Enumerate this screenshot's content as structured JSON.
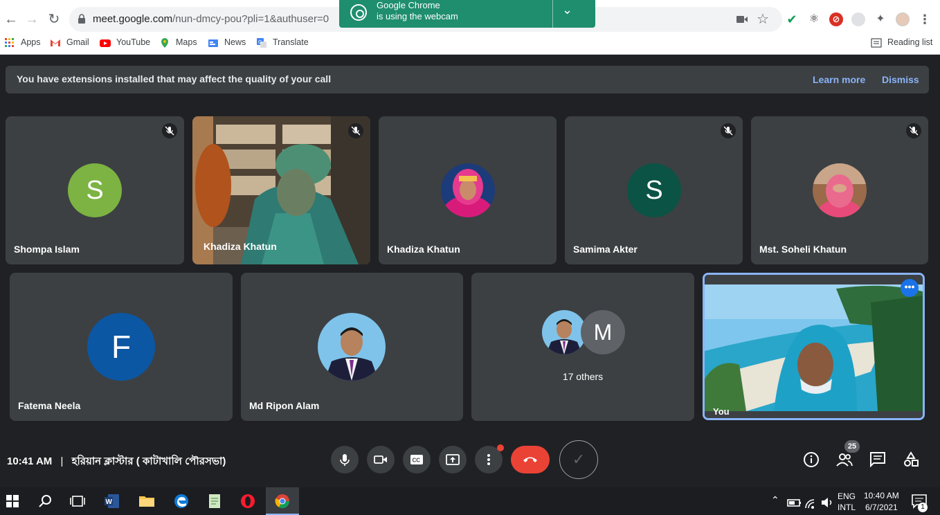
{
  "browser": {
    "url_host": "meet.google.com",
    "url_rest": "/nun-dmcy-pou?pli=1&authuser=0",
    "reading_list": "Reading list",
    "bookmarks": [
      {
        "label": "Apps",
        "icon": "apps-grid-icon"
      },
      {
        "label": "Gmail",
        "icon": "gmail-icon"
      },
      {
        "label": "YouTube",
        "icon": "youtube-icon"
      },
      {
        "label": "Maps",
        "icon": "maps-icon"
      },
      {
        "label": "News",
        "icon": "news-icon"
      },
      {
        "label": "Translate",
        "icon": "translate-icon"
      }
    ],
    "webcam_popup": {
      "title": "Google Chrome",
      "subtitle": "is using the webcam"
    }
  },
  "banner": {
    "message": "You have extensions installed that may affect the quality of your call",
    "learn_more": "Learn more",
    "dismiss": "Dismiss"
  },
  "participants": [
    {
      "name": "Shompa Islam",
      "initial": "S",
      "color": "#7cb342",
      "muted": true
    },
    {
      "name": "Khadiza Khatun",
      "video": true,
      "muted": true
    },
    {
      "name": "Khadiza Khatun",
      "photo": true,
      "muted": false
    },
    {
      "name": "Samima Akter",
      "initial": "S",
      "color": "#0b5345",
      "muted": true
    },
    {
      "name": "Mst. Soheli Khatun",
      "photo": true,
      "muted": true
    },
    {
      "name": "Fatema Neela",
      "initial": "F",
      "color": "#0b57a4"
    },
    {
      "name": "Md Ripon Alam",
      "photo": true
    },
    {
      "name": "17 others",
      "initial": "M",
      "color": "#5f6368"
    },
    {
      "name": "You",
      "self": true
    }
  ],
  "bottom": {
    "time": "10:41 AM",
    "separator": "|",
    "meeting_title": "হরিয়ান ক্লাস্টার ( কাটাখালি পৌরসভা)",
    "people_count": "25"
  },
  "taskbar": {
    "lang_top": "ENG",
    "lang_bottom": "INTL",
    "clock_time": "10:40 AM",
    "clock_date": "6/7/2021",
    "notifications": "1"
  }
}
